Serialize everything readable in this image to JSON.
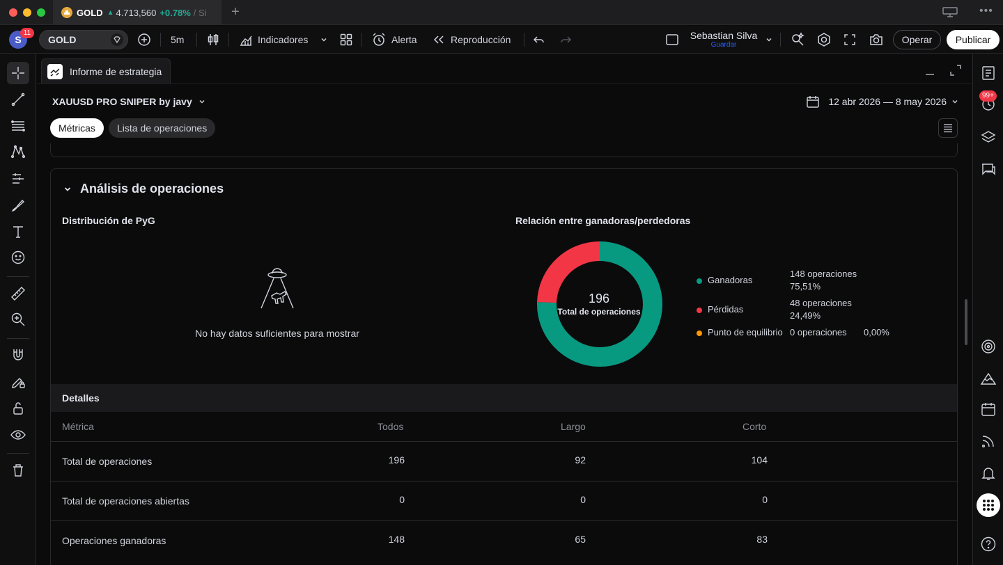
{
  "tabbar": {
    "symbol": "GOLD",
    "price": "4.713,560",
    "change": "+0.78%",
    "rest": "/ Si"
  },
  "toolbar": {
    "avatar_letter": "S",
    "avatar_badge": "11",
    "symbol": "GOLD",
    "interval": "5m",
    "indicators_label": "Indicadores",
    "alert_label": "Alerta",
    "replay_label": "Reproducción",
    "user_name": "Sebastian Silva",
    "user_sub": "Guardar",
    "operate_label": "Operar",
    "publish_label": "Publicar"
  },
  "rightbar": {
    "badge": "99+"
  },
  "panel": {
    "tab_label": "Informe de estrategia",
    "strategy_name": "XAUUSD PRO SNIPER by javy",
    "date_range": "12 abr 2026 — 8 may 2026",
    "tabs": [
      "Métricas",
      "Lista de operaciones"
    ]
  },
  "analysis": {
    "title": "Análisis de operaciones",
    "pnl_title": "Distribución de PyG",
    "no_data": "No hay datos suficientes para mostrar",
    "ratio_title": "Relación entre ganadoras/perdedoras",
    "total": "196",
    "total_label": "Total de operaciones",
    "legend": [
      {
        "name": "Ganadoras",
        "count": "148 operaciones",
        "pct": "75,51%",
        "color": "#089981"
      },
      {
        "name": "Pérdidas",
        "count": "48 operaciones",
        "pct": "24,49%",
        "color": "#f23645"
      },
      {
        "name": "Punto de equilibrio",
        "count": "0 operaciones",
        "pct": "0,00%",
        "color": "#ff9800"
      }
    ]
  },
  "chart_data": {
    "type": "pie",
    "categories": [
      "Ganadoras",
      "Pérdidas",
      "Punto de equilibrio"
    ],
    "values": [
      148,
      48,
      0
    ],
    "colors": [
      "#089981",
      "#f23645",
      "#ff9800"
    ]
  },
  "details": {
    "title": "Detalles",
    "columns": [
      "Métrica",
      "Todos",
      "Largo",
      "Corto"
    ],
    "rows": [
      {
        "label": "Total de operaciones",
        "all": "196",
        "long": "92",
        "short": "104"
      },
      {
        "label": "Total de operaciones abiertas",
        "all": "0",
        "long": "0",
        "short": "0"
      },
      {
        "label": "Operaciones ganadoras",
        "all": "148",
        "long": "65",
        "short": "83"
      }
    ]
  }
}
